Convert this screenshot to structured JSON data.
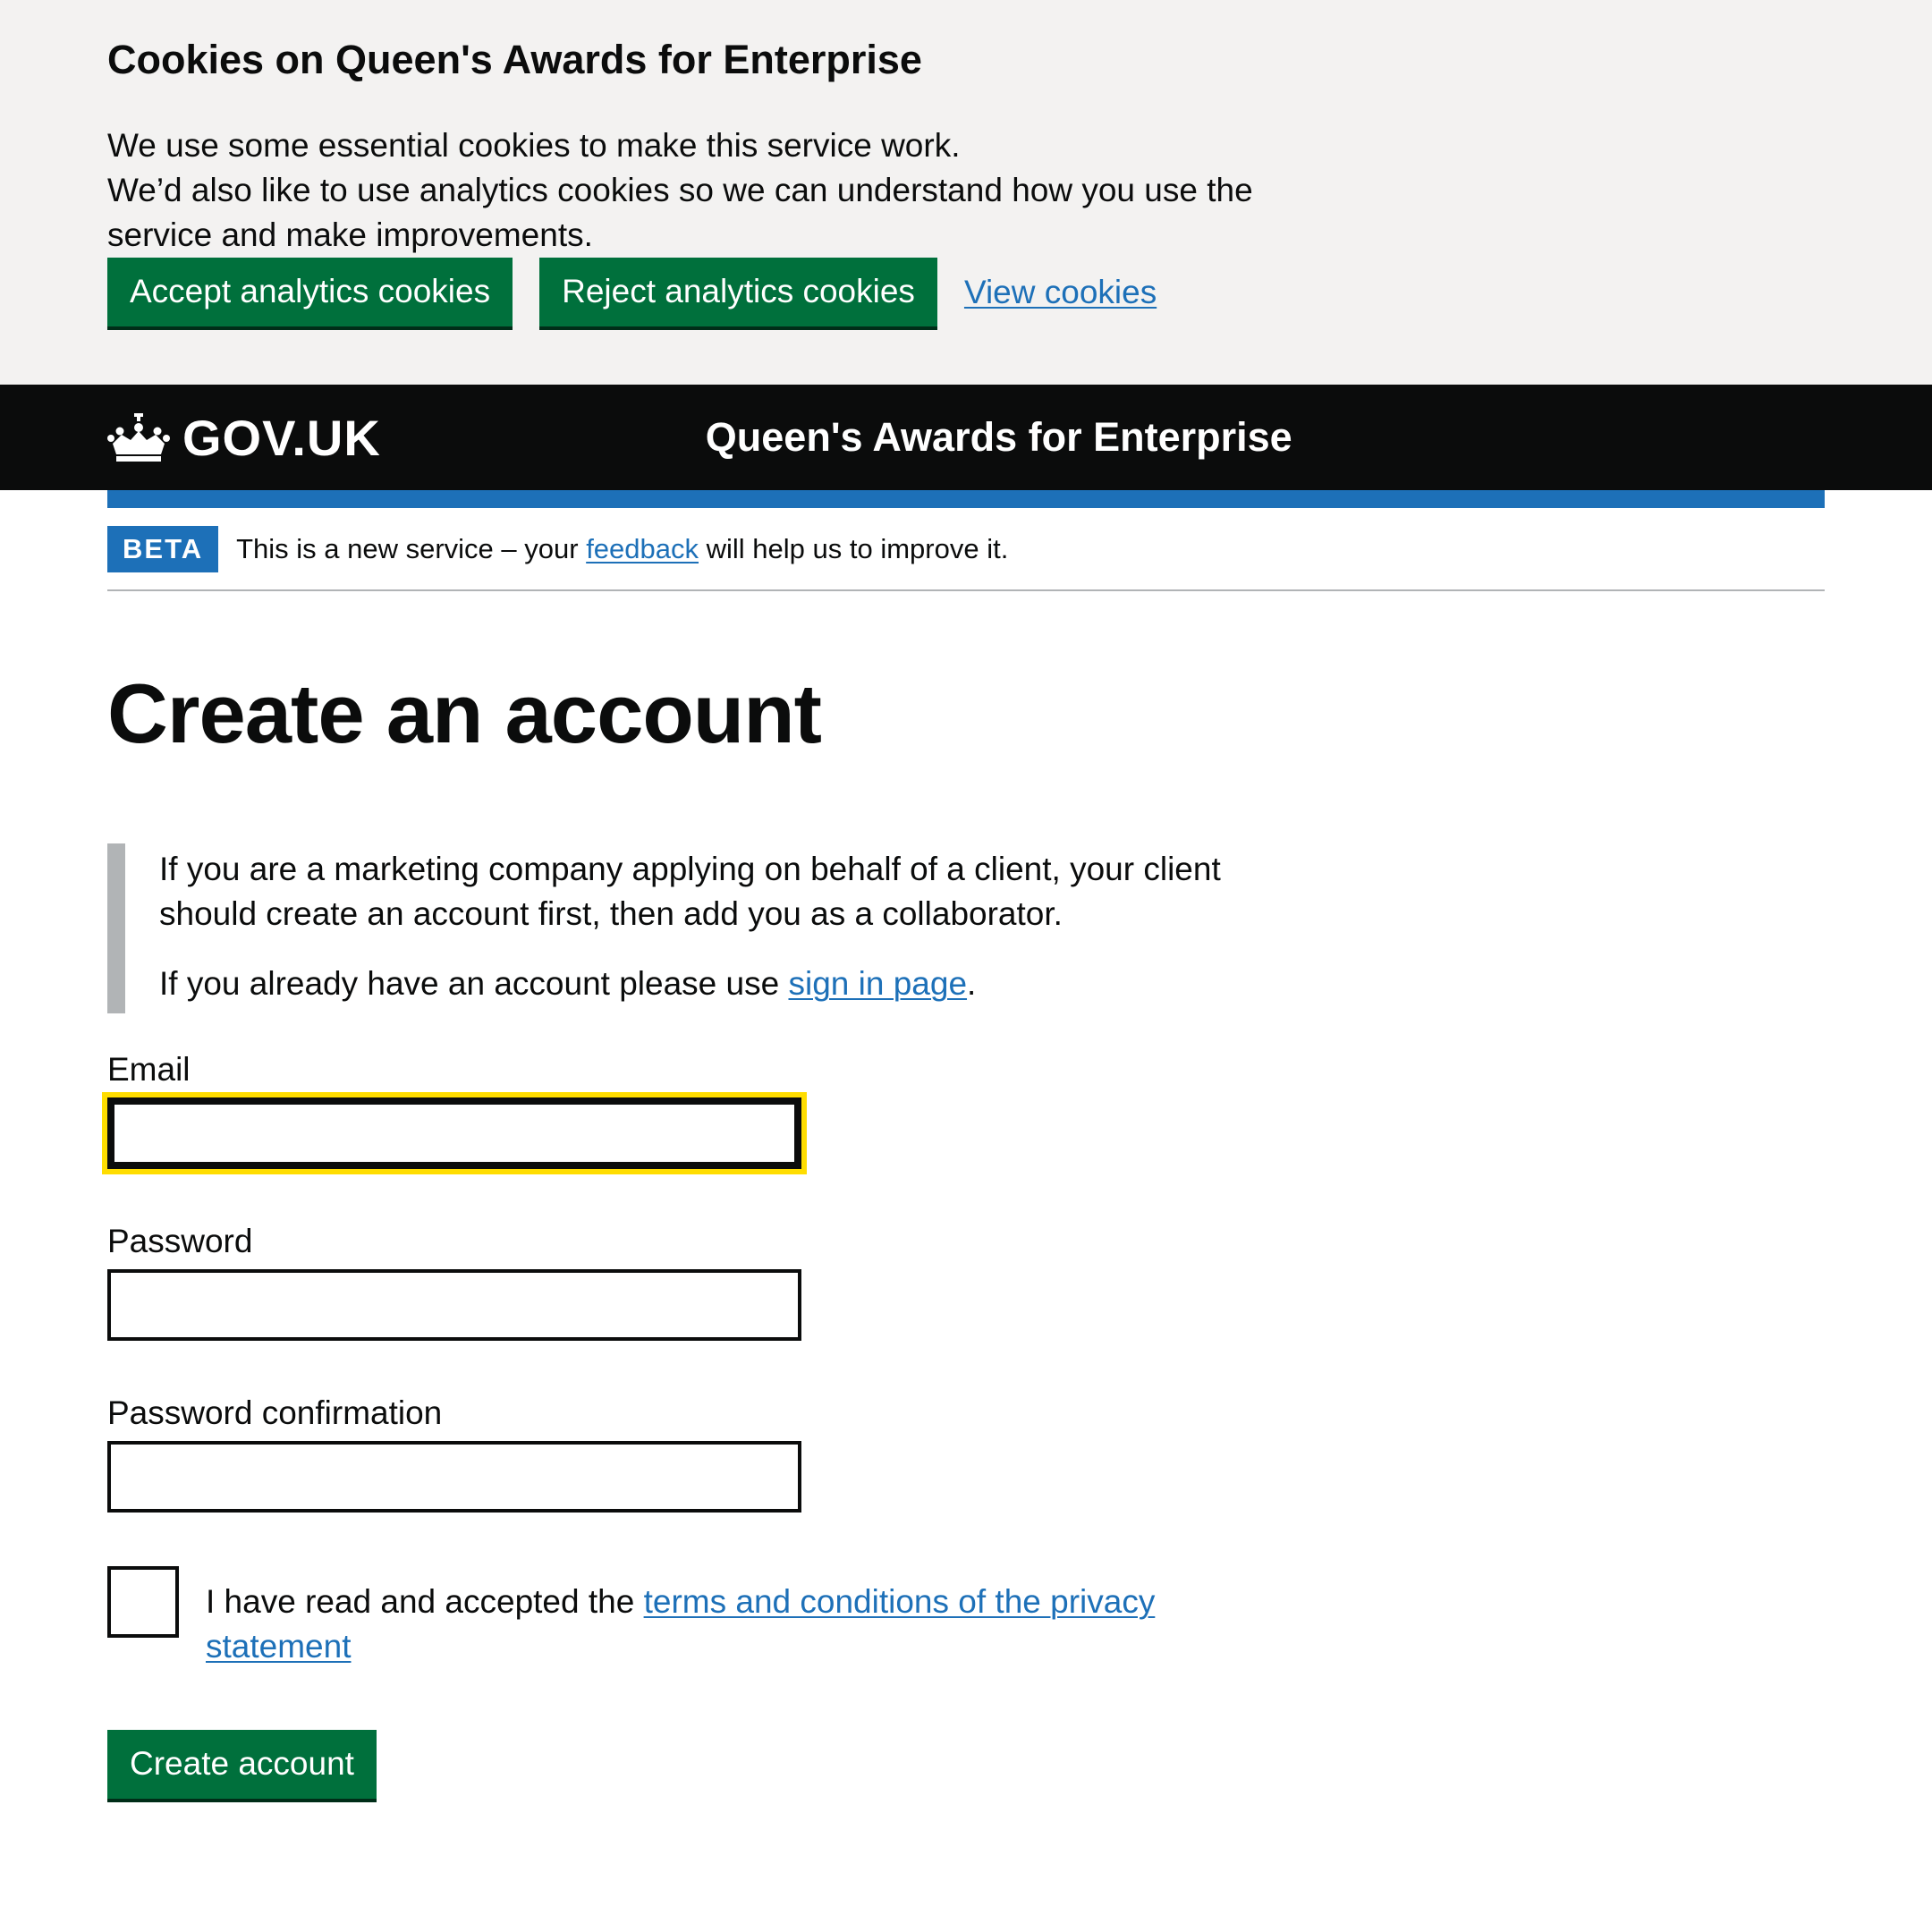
{
  "cookie_banner": {
    "title": "Cookies on Queen's Awards for Enterprise",
    "line1": "We use some essential cookies to make this service work.",
    "line2": "We’d also like to use analytics cookies so we can understand how you use the service and make improvements.",
    "accept_label": "Accept analytics cookies",
    "reject_label": "Reject analytics cookies",
    "view_label": "View cookies"
  },
  "header": {
    "logo_text": "GOV.UK",
    "service_name": "Queen's Awards for Enterprise"
  },
  "phase_banner": {
    "tag": "BETA",
    "text_before": "This is a new service – your ",
    "link": "feedback",
    "text_after": " will help us to improve it."
  },
  "main": {
    "title": "Create an account",
    "inset_line1": "If you are a marketing company applying on behalf of a client, your client should create an account first, then add you as a collaborator.",
    "inset_line2_before": "If you already have an account please use ",
    "inset_line2_link": "sign in page",
    "inset_line2_after": "."
  },
  "form": {
    "email_label": "Email",
    "email_value": "",
    "password_label": "Password",
    "password_value": "",
    "password_confirmation_label": "Password confirmation",
    "password_confirmation_value": "",
    "terms_before": "I have read and accepted the ",
    "terms_link": "terms and conditions of the privacy statement",
    "terms_checked": false,
    "submit_label": "Create account"
  },
  "colors": {
    "button_green": "#00703c",
    "link_blue": "#1d70b8",
    "header_black": "#0b0c0c",
    "focus_yellow": "#ffdd00",
    "banner_grey": "#f3f2f1"
  }
}
